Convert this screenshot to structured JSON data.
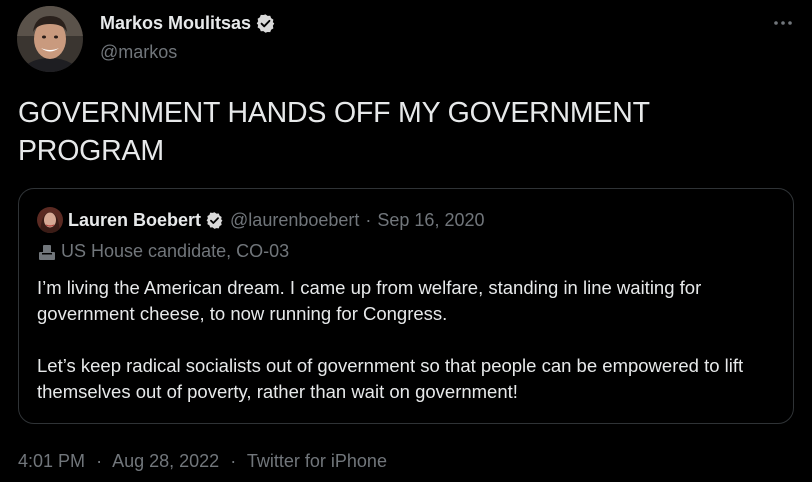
{
  "tweet": {
    "author": {
      "name": "Markos Moulitsas",
      "handle": "@markos",
      "verified": true
    },
    "text": "GOVERNMENT HANDS OFF MY GOVERNMENT PROGRAM",
    "time": "4:01 PM",
    "date": "Aug 28, 2022",
    "source": "Twitter for iPhone",
    "separator": "·"
  },
  "quoted_tweet": {
    "author": {
      "name": "Lauren Boebert",
      "handle": "@laurenboebert",
      "verified": true
    },
    "separator": "·",
    "date": "Sep 16, 2020",
    "label_icon": "ballot-box-icon",
    "label": "US House candidate, CO-03",
    "paragraphs": [
      "I’m living the American dream. I came up from welfare, standing in line waiting for government cheese, to now running for Congress.",
      "Let’s keep radical socialists out of government so that people can be empowered to lift themselves out of poverty, rather than wait on government!"
    ]
  },
  "icons": {
    "more": "more-horizontal-icon",
    "verified": "verified-badge-icon"
  },
  "colors": {
    "background": "#000000",
    "text_primary": "#e7e9ea",
    "text_secondary": "#71767b",
    "border": "#2f3336"
  }
}
